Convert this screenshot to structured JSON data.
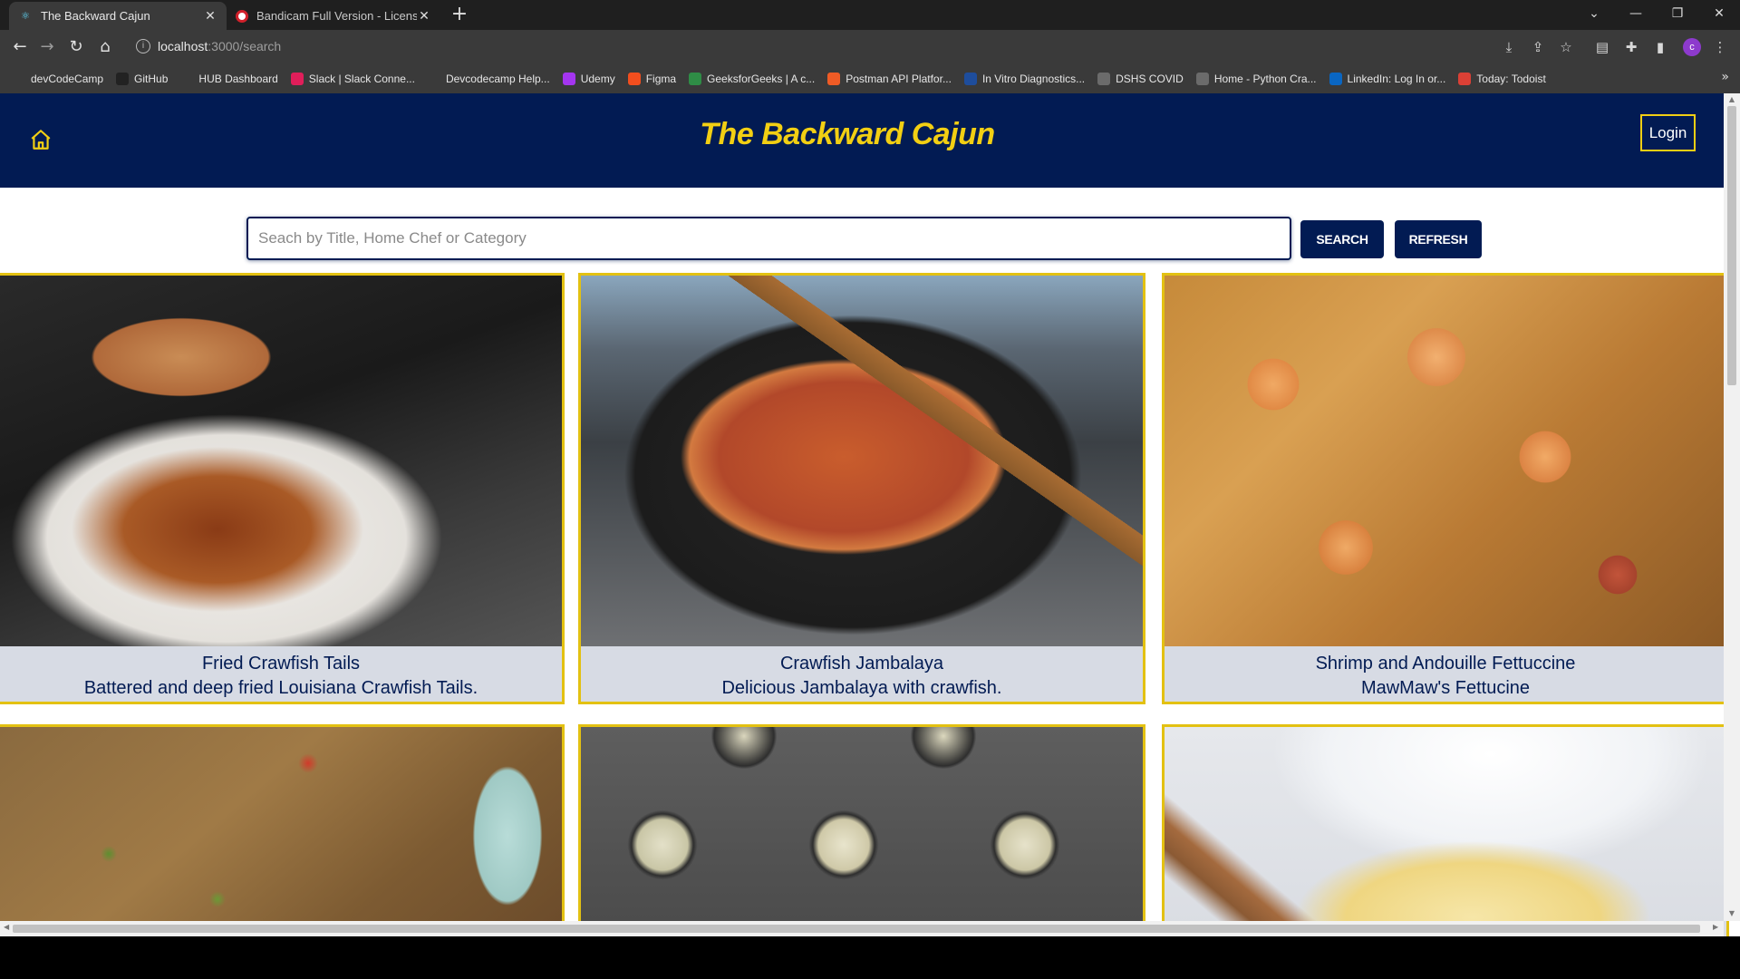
{
  "browser": {
    "tabs": [
      {
        "title": "The Backward Cajun",
        "active": true
      },
      {
        "title": "Bandicam Full Version - License r",
        "active": false
      }
    ],
    "url_host": "localhost",
    "url_path": ":3000/search",
    "profile_initial": "c",
    "bookmarks": [
      {
        "label": "devCodeCamp",
        "color": "#3a3a3a"
      },
      {
        "label": "GitHub",
        "color": "#222222"
      },
      {
        "label": "HUB Dashboard",
        "color": "#3a3a3a"
      },
      {
        "label": "Slack | Slack Conne...",
        "color": "#e01e5a"
      },
      {
        "label": "Devcodecamp Help...",
        "color": "#3a3a3a"
      },
      {
        "label": "Udemy",
        "color": "#a435f0"
      },
      {
        "label": "Figma",
        "color": "#f24e1e"
      },
      {
        "label": "GeeksforGeeks | A c...",
        "color": "#2f8d46"
      },
      {
        "label": "Postman API Platfor...",
        "color": "#ef5b25"
      },
      {
        "label": "In Vitro Diagnostics...",
        "color": "#1e4d9c"
      },
      {
        "label": "DSHS COVID",
        "color": "#6b6b6b"
      },
      {
        "label": "Home - Python Cra...",
        "color": "#6b6b6b"
      },
      {
        "label": "LinkedIn: Log In or...",
        "color": "#0a66c2"
      },
      {
        "label": "Today: Todoist",
        "color": "#db4035"
      }
    ]
  },
  "header": {
    "brand": "The Backward Cajun",
    "login_label": "Login"
  },
  "search": {
    "placeholder": "Seach by Title, Home Chef or Category",
    "value": "",
    "search_label": "SEARCH",
    "refresh_label": "REFRESH"
  },
  "recipes": [
    {
      "title": "Fried Crawfish Tails",
      "description": "Battered and deep fried Louisiana Crawfish Tails."
    },
    {
      "title": "Crawfish Jambalaya",
      "description": "Delicious Jambalaya with crawfish."
    },
    {
      "title": "Shrimp and Andouille Fettuccine",
      "description": "MawMaw's Fettucine"
    }
  ],
  "colors": {
    "navy": "#021b53",
    "gold": "#f2cf13",
    "card_border": "#e3c112"
  }
}
